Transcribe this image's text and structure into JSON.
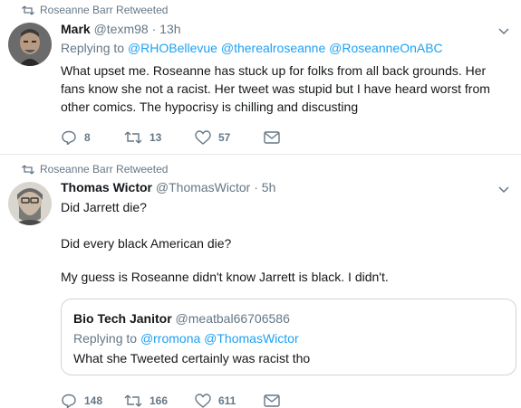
{
  "tweets": [
    {
      "retweeted_by": "Roseanne Barr Retweeted",
      "name": "Mark",
      "handle": "@texm98",
      "dot": "·",
      "time": "13h",
      "replying_prefix": "Replying to",
      "replying_to": [
        "@RHOBellevue",
        "@therealroseanne",
        "@RoseanneOnABC"
      ],
      "text": "What upset me. Roseanne has stuck up for folks from all back grounds. Her fans know she not a racist. Her tweet was stupid but I have heard worst from other comics. The hypocrisy is chilling and discusting",
      "replies": "8",
      "retweets": "13",
      "likes": "57"
    },
    {
      "retweeted_by": "Roseanne Barr Retweeted",
      "name": "Thomas Wictor",
      "handle": "@ThomasWictor",
      "dot": "·",
      "time": "5h",
      "lines": [
        "Did Jarrett die?",
        "Did every black American die?",
        "My guess is Roseanne didn't know Jarrett is black. I didn't."
      ],
      "quote": {
        "name": "Bio Tech Janitor",
        "handle": "@meatbal66706586",
        "replying_prefix": "Replying to",
        "replying_to": [
          "@rromona",
          "@ThomasWictor"
        ],
        "text": "What she Tweeted certainly was racist tho"
      },
      "replies": "148",
      "retweets": "166",
      "likes": "611"
    }
  ],
  "colors": {
    "accent": "#1da1f2",
    "muted": "#657786",
    "text": "#14171a",
    "border": "#e6ecf0"
  }
}
